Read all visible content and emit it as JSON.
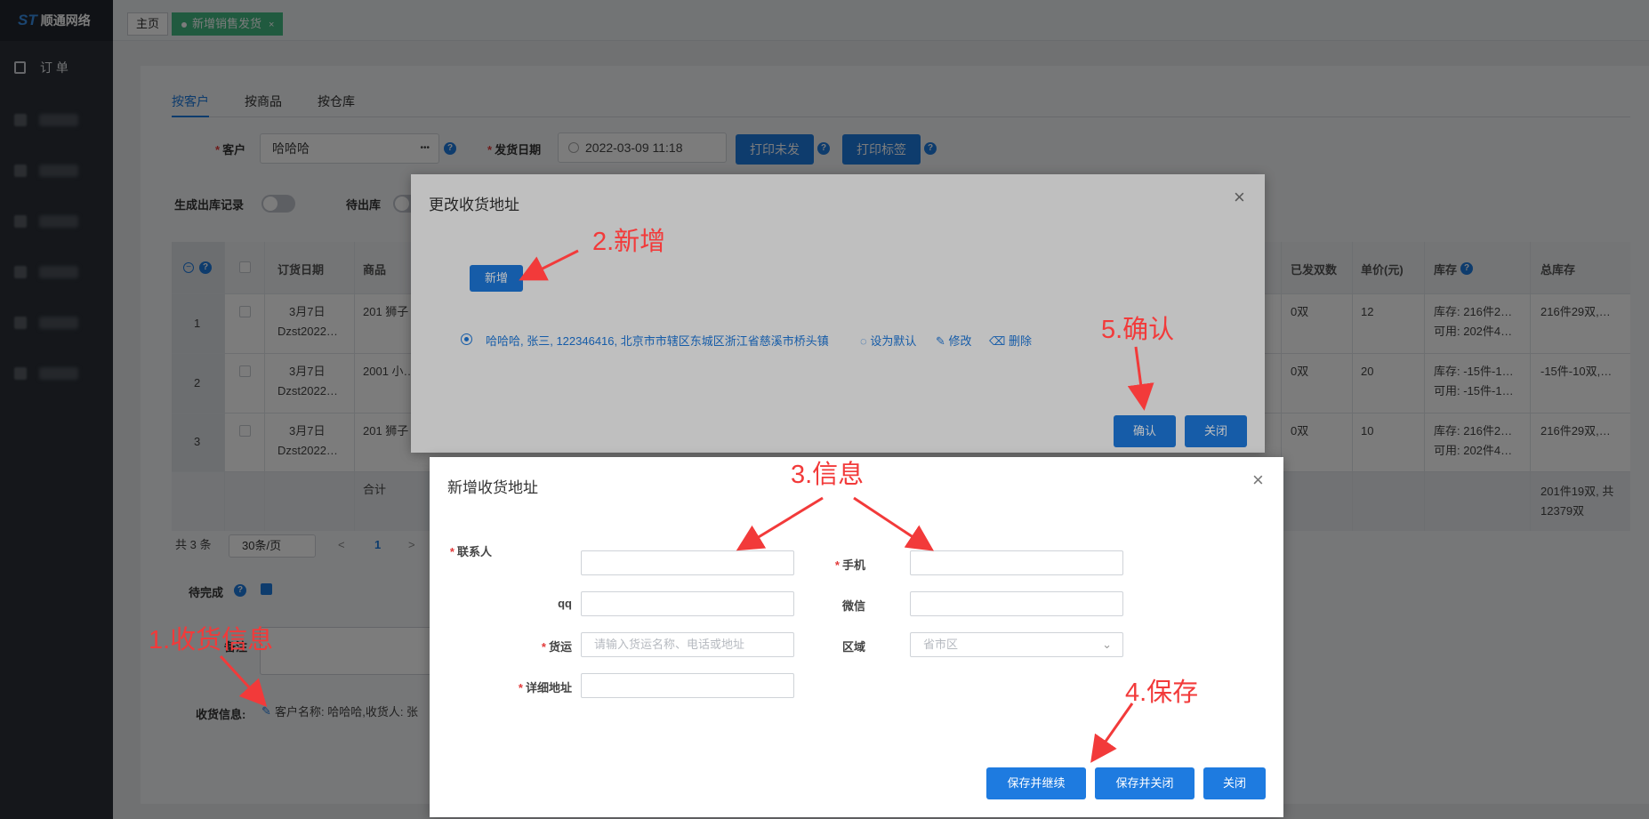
{
  "sidebar": {
    "logo": "顺通网络",
    "logo_mark": "ST",
    "menu_item": "订 单"
  },
  "tabs": {
    "home": "主页",
    "active": "新增销售发货"
  },
  "page_tabs": [
    "按客户",
    "按商品",
    "按仓库"
  ],
  "form": {
    "customer_label": "客户",
    "customer_value": "哈哈哈",
    "customer_more": "•••",
    "date_label": "发货日期",
    "date_value": "2022-03-09 11:18",
    "print_unsent": "打印未发",
    "print_label": "打印标签",
    "gen_record_label": "生成出库记录",
    "pending_out_label": "待出库"
  },
  "table": {
    "headers": [
      "订货日期",
      "商品",
      "已发双数",
      "单价(元)",
      "库存",
      "总库存"
    ],
    "rows": [
      {
        "no": "1",
        "date": "3月7日",
        "code": "Dzst2022…",
        "product": "201 狮子",
        "sent": "0双",
        "price": "12",
        "stock1": "库存: 216件2…",
        "stock2": "可用: 202件4…",
        "total": "216件29双,…"
      },
      {
        "no": "2",
        "date": "3月7日",
        "code": "Dzst2022…",
        "product": "2001 小…",
        "sent": "0双",
        "price": "20",
        "stock1": "库存: -15件-1…",
        "stock2": "可用: -15件-1…",
        "total": "-15件-10双,…"
      },
      {
        "no": "3",
        "date": "3月7日",
        "code": "Dzst2022…",
        "product": "201 狮子",
        "sent": "0双",
        "price": "10",
        "stock1": "库存: 216件2…",
        "stock2": "可用: 202件4…",
        "total": "216件29双,…"
      }
    ],
    "total_label": "合计",
    "total_value_1": "201件19双, 共",
    "total_value_2": "12379双"
  },
  "pager": {
    "count": "共 3 条",
    "size": "30条/页",
    "page": "1",
    "prev": "<",
    "next": ">"
  },
  "bottom": {
    "pending_done": "待完成",
    "remark": "备注",
    "receive_label": "收货信息:",
    "receive_value": "客户名称: 哈哈哈,收货人: 张"
  },
  "dialog_change": {
    "title": "更改收货地址",
    "add_button": "新增",
    "address": "哈哈哈, 张三, 122346416, 北京市市辖区东城区浙江省慈溪市桥头镇",
    "set_default": "设为默认",
    "edit": "修改",
    "delete": "删除",
    "confirm": "确认",
    "close": "关闭"
  },
  "dialog_add": {
    "title": "新增收货地址",
    "contact_label": "联系人",
    "phone_label": "手机",
    "qq_label": "qq",
    "wechat_label": "微信",
    "freight_label": "货运",
    "freight_placeholder": "请输入货运名称、电话或地址",
    "region_label": "区域",
    "region_placeholder": "省市区",
    "address_label": "详细地址",
    "save_continue": "保存并继续",
    "save_close": "保存并关闭",
    "close": "关闭"
  },
  "annotations": {
    "a1": "1.收货信息",
    "a2": "2.新增",
    "a3": "3.信息",
    "a4": "4.保存",
    "a5": "5.确认",
    "color": "#f23a3a"
  },
  "colors": {
    "primary": "#1e7be0",
    "tab_active": "#42b983",
    "sidebar": "#2b3038"
  }
}
